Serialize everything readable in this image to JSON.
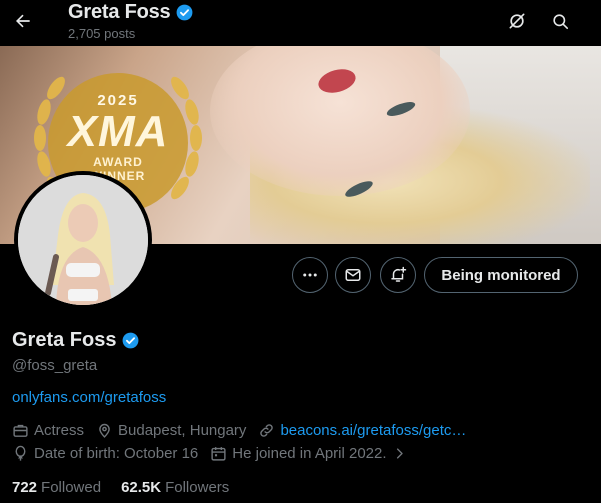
{
  "header": {
    "name": "Greta Foss",
    "posts_count": "2,705 posts"
  },
  "banner": {
    "award_year": "2025",
    "award_logo": "XMA",
    "award_line1": "AWARD",
    "award_line2": "WINNER"
  },
  "actions": {
    "monitor_label": "Being monitored"
  },
  "profile": {
    "name": "Greta Foss",
    "handle": "@foss_greta",
    "bio_link": "onlyfans.com/gretafoss",
    "category": "Actress",
    "location": "Budapest, Hungary",
    "website": "beacons.ai/gretafoss/getc…",
    "birth": "Date of birth: October 16",
    "joined": "He joined in April 2022.",
    "following_count": "722",
    "following_label": "Followed",
    "followers_count": "62.5K",
    "followers_label": "Followers"
  },
  "colors": {
    "background": "#000000",
    "text_primary": "#e7e9ea",
    "text_secondary": "#71767b",
    "link": "#1d9bf0",
    "verified": "#1d9bf0",
    "border": "#536471"
  }
}
